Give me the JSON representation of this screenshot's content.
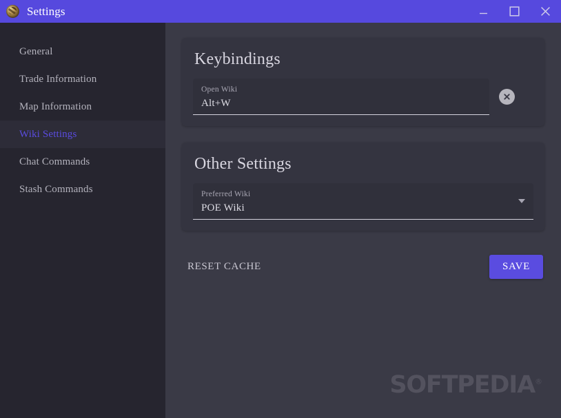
{
  "window": {
    "title": "Settings",
    "app_icon": "poe-orb-icon",
    "controls": {
      "minimize": "minimize-icon",
      "maximize": "maximize-icon",
      "close": "close-icon"
    }
  },
  "sidebar": {
    "items": [
      {
        "label": "General",
        "active": false
      },
      {
        "label": "Trade Information",
        "active": false
      },
      {
        "label": "Map Information",
        "active": false
      },
      {
        "label": "Wiki Settings",
        "active": true
      },
      {
        "label": "Chat Commands",
        "active": false
      },
      {
        "label": "Stash Commands",
        "active": false
      }
    ]
  },
  "main": {
    "keybindings_card": {
      "title": "Keybindings",
      "field": {
        "label": "Open Wiki",
        "value": "Alt+W"
      },
      "clear_icon": "clear-circle-icon"
    },
    "other_settings_card": {
      "title": "Other Settings",
      "field": {
        "label": "Preferred Wiki",
        "value": "POE Wiki"
      },
      "caret_icon": "chevron-down-icon"
    },
    "actions": {
      "reset_label": "RESET CACHE",
      "save_label": "SAVE"
    }
  },
  "watermark": {
    "text": "SOFTPEDIA",
    "mark": "®"
  },
  "colors": {
    "accent": "#5a4ce0",
    "titlebar": "#5649de",
    "sidebar_bg": "#26252f",
    "sidebar_active_bg": "#2d2c38",
    "main_bg": "#3a3a46",
    "card_bg": "#343440",
    "field_bg": "#30303b",
    "text_primary": "#dddce4",
    "text_muted": "#a9a7b4",
    "watermark": "#53525e"
  }
}
